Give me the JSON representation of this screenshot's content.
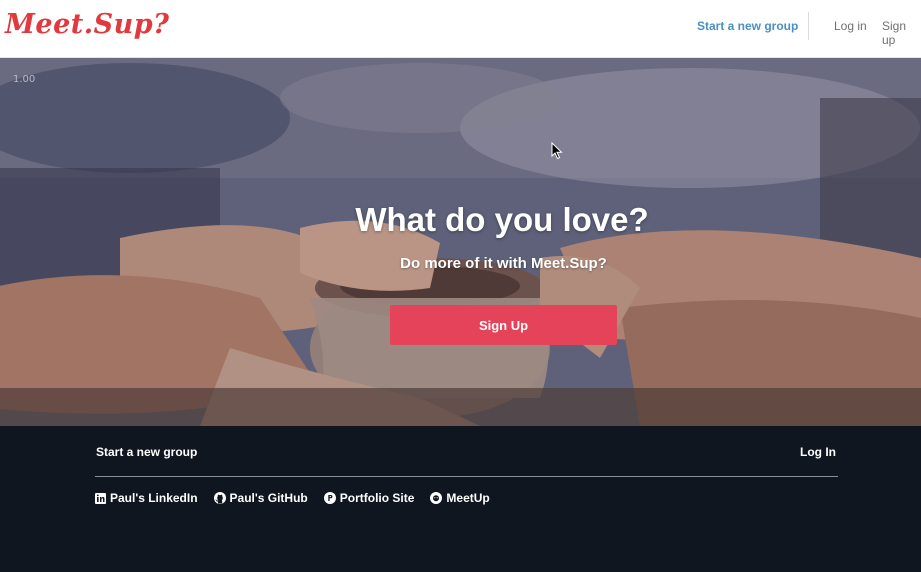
{
  "header": {
    "logo": "Meet.Sup?",
    "start_group": "Start a new group",
    "log_in": "Log in",
    "sign_up": "Sign up"
  },
  "hero": {
    "zoom": "1.00",
    "title": "What do you love?",
    "subtitle": "Do more of it with Meet.Sup?",
    "cta": "Sign Up"
  },
  "footer": {
    "start_group": "Start a new group",
    "log_in": "Log In",
    "links": [
      {
        "label": "Paul's LinkedIn",
        "icon": "linkedin-icon"
      },
      {
        "label": "Paul's GitHub",
        "icon": "github-icon"
      },
      {
        "label": "Portfolio Site",
        "icon": "portfolio-icon"
      },
      {
        "label": "MeetUp",
        "icon": "meetup-icon"
      }
    ]
  },
  "colors": {
    "brand": "#e0393e",
    "accent_link": "#4a90c0",
    "cta": "#e5435a",
    "footer_bg": "#0f1620"
  }
}
